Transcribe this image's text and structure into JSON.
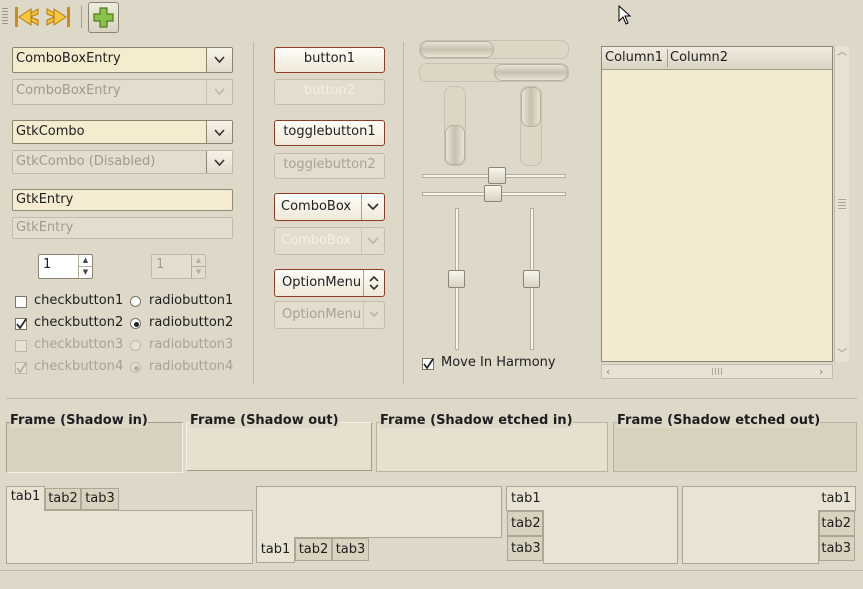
{
  "toolbar": {
    "back_icon": "go-back-icon",
    "forward_icon": "go-forward-icon",
    "add_icon": "add-icon"
  },
  "col1": {
    "combo_entry_1": "ComboBoxEntry",
    "combo_entry_2": "ComboBoxEntry",
    "gtkcombo_1": "GtkCombo",
    "gtkcombo_2": "GtkCombo (Disabled)",
    "entry_1": "GtkEntry",
    "entry_2": "GtkEntry",
    "spin_1": "1",
    "spin_2": "1",
    "checks": [
      "checkbutton1",
      "checkbutton2",
      "checkbutton3",
      "checkbutton4"
    ],
    "radios": [
      "radiobutton1",
      "radiobutton2",
      "radiobutton3",
      "radiobutton4"
    ]
  },
  "col2": {
    "button1": "button1",
    "button2": "button2",
    "toggle1": "togglebutton1",
    "toggle2": "togglebutton2",
    "combobox1": "ComboBox",
    "combobox2": "ComboBox",
    "option1": "OptionMenu",
    "option2": "OptionMenu"
  },
  "col3": {
    "progress": [
      0.33,
      0.33,
      0.5,
      0.5
    ],
    "harmony": "Move In Harmony"
  },
  "tree": {
    "columns": [
      "Column1",
      "Column2"
    ]
  },
  "frames": [
    "Frame (Shadow in)",
    "Frame (Shadow out)",
    "Frame (Shadow etched in)",
    "Frame (Shadow etched out)"
  ],
  "notebooks": {
    "tabs": [
      "tab1",
      "tab2",
      "tab3"
    ]
  }
}
